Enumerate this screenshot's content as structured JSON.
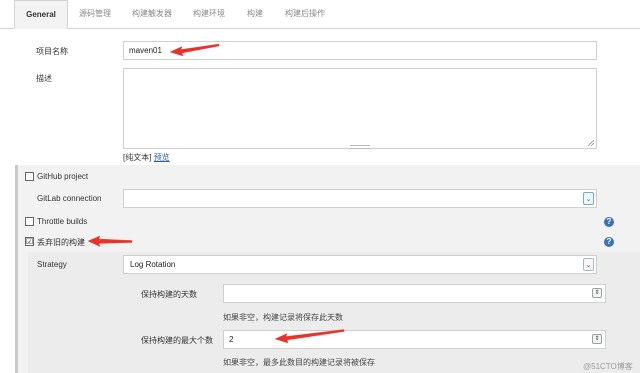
{
  "tabs": [
    "General",
    "源码管理",
    "构建触发器",
    "构建环境",
    "构建",
    "构建后操作"
  ],
  "project_name": {
    "label": "项目名称",
    "value": "maven01"
  },
  "description": {
    "label": "描述",
    "plain_text": "[纯文本]",
    "preview_link": "预览"
  },
  "github_project": {
    "label": "GitHub project",
    "checked": false
  },
  "gitlab_connection": {
    "label": "GitLab connection",
    "value": ""
  },
  "throttle_builds": {
    "label": "Throttle builds",
    "checked": false
  },
  "discard_old_builds": {
    "label": "丢弃旧的构建",
    "checked": true,
    "checkmark": "☑"
  },
  "strategy": {
    "label": "Strategy",
    "value": "Log Rotation"
  },
  "days_to_keep": {
    "label": "保持构建的天数",
    "value": "",
    "hint": "如果非空，构建记录将保存此天数"
  },
  "max_builds": {
    "label": "保持构建的最大个数",
    "value": "2",
    "hint": "如果非空，最多此数目的构建记录将被保存"
  },
  "watermark": "@51CTO博客",
  "icons": {
    "help": "?",
    "dropdown": "⌄",
    "spinner": "⇕"
  },
  "colors": {
    "arrow": "#e8322a",
    "help": "#3d72b5"
  }
}
